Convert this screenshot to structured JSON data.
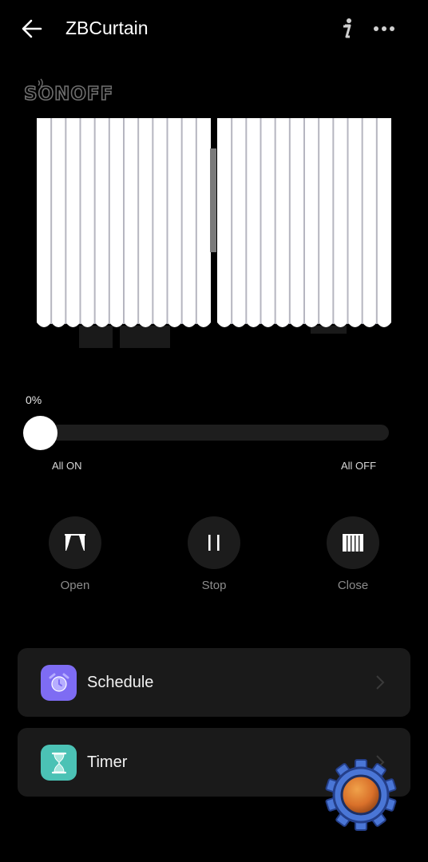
{
  "header": {
    "title": "ZBCurtain",
    "icons": {
      "back": "arrow-left-icon",
      "info": "info-icon",
      "more": "more-horizontal-icon"
    }
  },
  "brand": {
    "logo_text": "SONOFF"
  },
  "slider": {
    "percent_label": "0%",
    "value": 0,
    "left_label": "All ON",
    "right_label": "All OFF"
  },
  "controls": [
    {
      "label": "Open",
      "icon": "curtain-open-icon"
    },
    {
      "label": "Stop",
      "icon": "pause-icon"
    },
    {
      "label": "Close",
      "icon": "curtain-closed-icon"
    }
  ],
  "cards": [
    {
      "label": "Schedule",
      "icon": "alarm-clock-icon",
      "icon_bg": "#7e6cf3"
    },
    {
      "label": "Timer",
      "icon": "hourglass-icon",
      "icon_bg": "#4bc2b5"
    }
  ],
  "colors": {
    "background": "#000000",
    "card": "#1a1a1a",
    "control_circle": "#1c1c1c",
    "schedule_accent": "#7e6cf3",
    "timer_accent": "#4bc2b5",
    "gear_blue": "#3f67c6",
    "gear_orange": "#e0782a"
  }
}
